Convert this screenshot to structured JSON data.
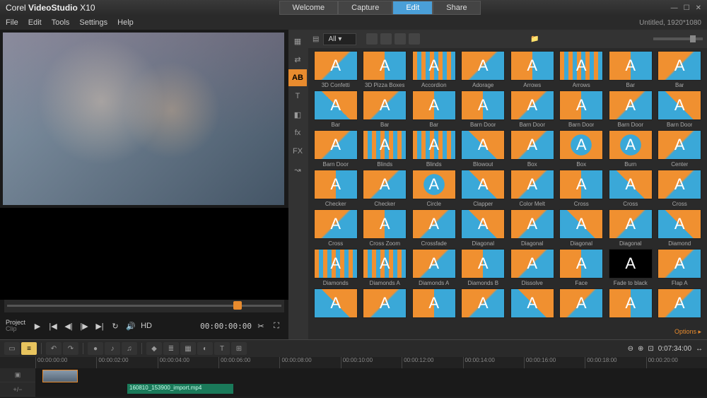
{
  "app": {
    "brand": "Corel",
    "name": "VideoStudio",
    "version": "X10"
  },
  "main_tabs": [
    "Welcome",
    "Capture",
    "Edit",
    "Share"
  ],
  "main_tab_active": 2,
  "menu": [
    "File",
    "Edit",
    "Tools",
    "Settings",
    "Help"
  ],
  "project_info": "Untitled, 1920*1080",
  "preview": {
    "mode_label": "Project",
    "sub_label": "Clip",
    "timecode": "00:00:00:00",
    "hd_label": "HD"
  },
  "library": {
    "filter_label": "All",
    "sidebar_tabs": [
      "media",
      "swap",
      "AB",
      "T",
      "layers",
      "fx",
      "FX",
      "path"
    ],
    "sidebar_active": 2,
    "footer": "Options ▸",
    "transitions": [
      {
        "name": "3D Confetti",
        "v": 0
      },
      {
        "name": "3D Pizza Boxes",
        "v": 1
      },
      {
        "name": "Accordion",
        "v": 3
      },
      {
        "name": "Adorage",
        "v": 0
      },
      {
        "name": "Arrows",
        "v": 1
      },
      {
        "name": "Arrows",
        "v": 3
      },
      {
        "name": "Bar",
        "v": 1
      },
      {
        "name": "Bar",
        "v": 0
      },
      {
        "name": "Bar",
        "v": 4
      },
      {
        "name": "Bar",
        "v": 0
      },
      {
        "name": "Bar",
        "v": 1
      },
      {
        "name": "Barn Door",
        "v": 1
      },
      {
        "name": "Barn Door",
        "v": 0
      },
      {
        "name": "Barn Door",
        "v": 1
      },
      {
        "name": "Barn Door",
        "v": 0
      },
      {
        "name": "Barn Door",
        "v": 4
      },
      {
        "name": "Barn Door",
        "v": 0
      },
      {
        "name": "Blinds",
        "v": 3
      },
      {
        "name": "Blinds",
        "v": 3
      },
      {
        "name": "Blowout",
        "v": 4
      },
      {
        "name": "Box",
        "v": 0
      },
      {
        "name": "Box",
        "v": 2
      },
      {
        "name": "Burn",
        "v": 2
      },
      {
        "name": "Center",
        "v": 0
      },
      {
        "name": "Checker",
        "v": 1
      },
      {
        "name": "Checker",
        "v": 0
      },
      {
        "name": "Circle",
        "v": 2
      },
      {
        "name": "Clapper",
        "v": 4
      },
      {
        "name": "Color Melt",
        "v": 0
      },
      {
        "name": "Cross",
        "v": 1
      },
      {
        "name": "Cross",
        "v": 4
      },
      {
        "name": "Cross",
        "v": 0
      },
      {
        "name": "Cross",
        "v": 0
      },
      {
        "name": "Cross Zoom",
        "v": 1
      },
      {
        "name": "Crossfade",
        "v": 0
      },
      {
        "name": "Diagonal",
        "v": 4
      },
      {
        "name": "Diagonal",
        "v": 0
      },
      {
        "name": "Diagonal",
        "v": 4
      },
      {
        "name": "Diagonal",
        "v": 0
      },
      {
        "name": "Diamond",
        "v": 4
      },
      {
        "name": "Diamonds",
        "v": 3
      },
      {
        "name": "Diamonds A",
        "v": 3
      },
      {
        "name": "Diamonds A",
        "v": 0
      },
      {
        "name": "Diamonds B",
        "v": 1
      },
      {
        "name": "Dissolve",
        "v": 0
      },
      {
        "name": "Face",
        "v": 1
      },
      {
        "name": "Fade to black",
        "v": "black"
      },
      {
        "name": "Flap A",
        "v": 0
      },
      {
        "name": "",
        "v": 4
      },
      {
        "name": "",
        "v": 0
      },
      {
        "name": "",
        "v": 1
      },
      {
        "name": "",
        "v": 0
      },
      {
        "name": "",
        "v": 4
      },
      {
        "name": "",
        "v": 0
      },
      {
        "name": "",
        "v": 1
      },
      {
        "name": "",
        "v": 0
      }
    ]
  },
  "timeline": {
    "ticks": [
      "00:00:00:00",
      "00:00:02:00",
      "00:00:04:00",
      "00:00:06:00",
      "00:00:08:00",
      "00:00:10:00",
      "00:00:12:00",
      "00:00:14:00",
      "00:00:16:00",
      "00:00:18:00",
      "00:00:20:00"
    ],
    "timecode": "0:07:34:00",
    "clip_label": "160810_153900_import.mp4"
  }
}
